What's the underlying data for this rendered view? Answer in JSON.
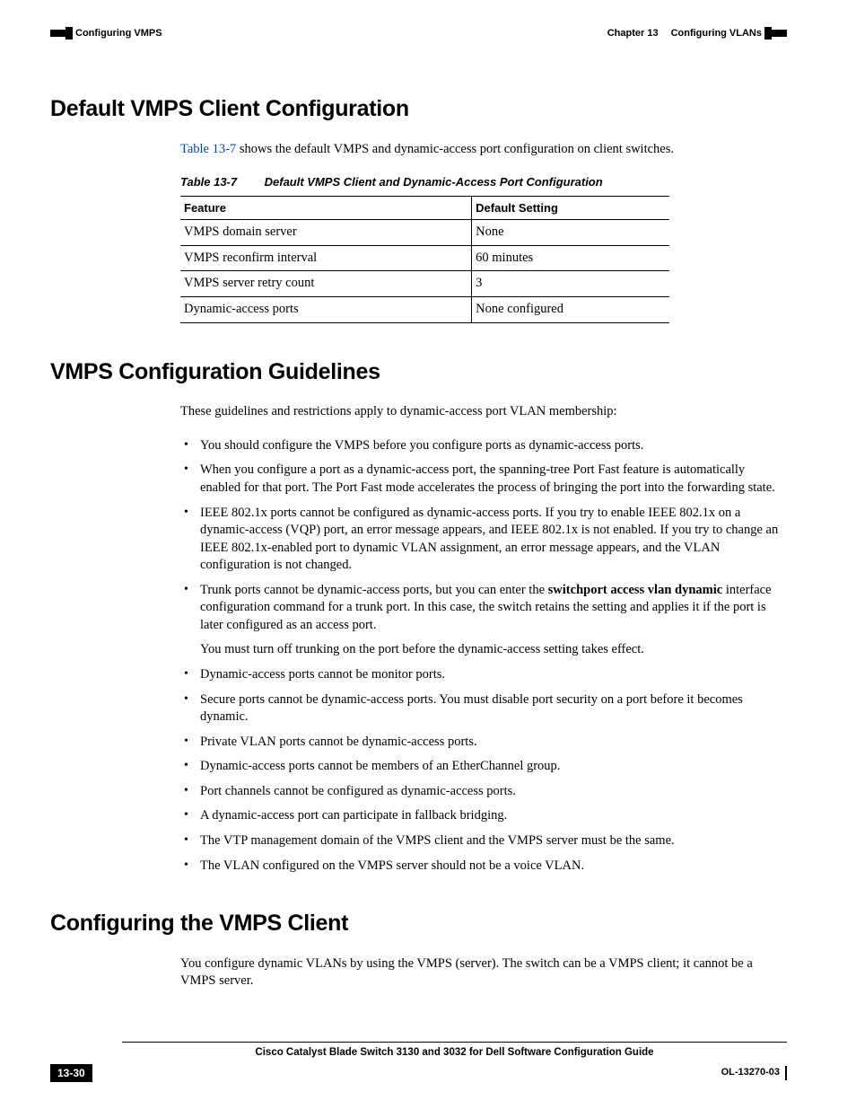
{
  "header": {
    "chapter_label": "Chapter 13",
    "chapter_title": "Configuring VLANs",
    "section_title": "Configuring VMPS"
  },
  "section1": {
    "heading": "Default VMPS Client Configuration",
    "intro_pre": "Table 13-7",
    "intro_post": " shows the default VMPS and dynamic-access port configuration on client switches.",
    "table_num": "Table 13-7",
    "table_title": "Default VMPS Client and Dynamic-Access Port Configuration",
    "col1": "Feature",
    "col2": "Default Setting",
    "rows": [
      {
        "feature": "VMPS domain server",
        "setting": "None"
      },
      {
        "feature": "VMPS reconfirm interval",
        "setting": "60 minutes"
      },
      {
        "feature": "VMPS server retry count",
        "setting": "3"
      },
      {
        "feature": "Dynamic-access ports",
        "setting": "None configured"
      }
    ]
  },
  "section2": {
    "heading": "VMPS Configuration Guidelines",
    "intro": "These guidelines and restrictions apply to dynamic-access port VLAN membership:",
    "bullets": {
      "b0": "You should configure the VMPS before you configure ports as dynamic-access ports.",
      "b1": "When you configure a port as a dynamic-access port, the spanning-tree Port Fast feature is automatically enabled for that port. The Port Fast mode accelerates the process of bringing the port into the forwarding state.",
      "b2": "IEEE 802.1x ports cannot be configured as dynamic-access ports. If you try to enable IEEE 802.1x on a dynamic-access (VQP) port, an error message appears, and IEEE 802.1x is not enabled. If you try to change an IEEE 802.1x-enabled port to dynamic VLAN assignment, an error message appears, and the VLAN configuration is not changed.",
      "b3_pre": "Trunk ports cannot be dynamic-access ports, but you can enter the ",
      "b3_bold": "switchport access vlan dynamic",
      "b3_post": " interface configuration command for a trunk port. In this case, the switch retains the setting and applies it if the port is later configured as an access port.",
      "b3_sub": "You must turn off trunking on the port before the dynamic-access setting takes effect.",
      "b4": "Dynamic-access ports cannot be monitor ports.",
      "b5": "Secure ports cannot be dynamic-access ports. You must disable port security on a port before it becomes dynamic.",
      "b6": "Private VLAN ports cannot be dynamic-access ports.",
      "b7": "Dynamic-access ports cannot be members of an EtherChannel group.",
      "b8": "Port channels cannot be configured as dynamic-access ports.",
      "b9": "A dynamic-access port can participate in fallback bridging.",
      "b10": "The VTP management domain of the VMPS client and the VMPS server must be the same.",
      "b11": "The VLAN configured on the VMPS server should not be a voice VLAN."
    }
  },
  "section3": {
    "heading": "Configuring the VMPS Client",
    "intro": "You configure dynamic VLANs by using the VMPS (server). The switch can be a VMPS client; it cannot be a VMPS server."
  },
  "footer": {
    "book_title": "Cisco Catalyst Blade Switch 3130 and 3032 for Dell Software Configuration Guide",
    "page_num": "13-30",
    "doc_id": "OL-13270-03"
  }
}
